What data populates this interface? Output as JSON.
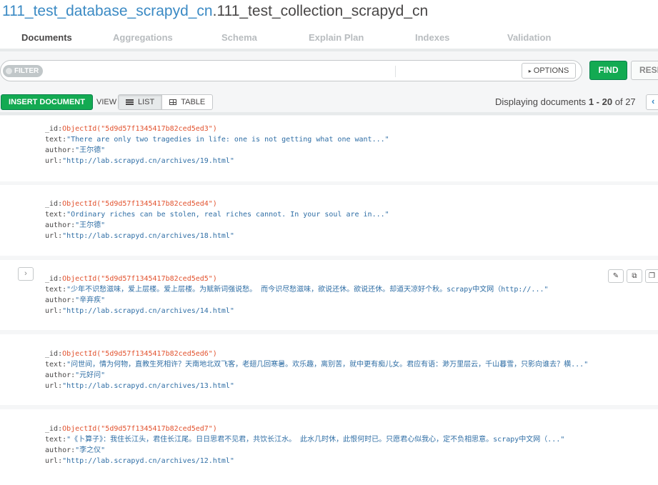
{
  "header": {
    "db_name": "111_test_database_scrapyd_cn",
    "separator": ".",
    "collection_name": "111_test_collection_scrapyd_cn"
  },
  "tabs": [
    {
      "label": "Documents",
      "active": true
    },
    {
      "label": "Aggregations",
      "active": false
    },
    {
      "label": "Schema",
      "active": false
    },
    {
      "label": "Explain Plan",
      "active": false
    },
    {
      "label": "Indexes",
      "active": false
    },
    {
      "label": "Validation",
      "active": false
    }
  ],
  "query": {
    "filter_label": "FILTER",
    "options_label": "OPTIONS",
    "find_label": "FIND",
    "reset_label": "RESET"
  },
  "toolbar": {
    "insert_label": "INSERT DOCUMENT",
    "view_label": "VIEW",
    "list_label": "LIST",
    "table_label": "TABLE",
    "display_prefix": "Displaying documents",
    "range_start": "1",
    "range_sep": "-",
    "range_end": "20",
    "of_label": "of",
    "total": "27"
  },
  "field_keys": {
    "id": "_id",
    "text": "text",
    "author": "author",
    "url": "url"
  },
  "documents": [
    {
      "id": "ObjectId(\"5d9d57f1345417b82ced5ed3\")",
      "text": "\"There are only two tragedies in life: one is not getting what one want...\"",
      "author": "\"王尔德\"",
      "url": "\"http://lab.scrapyd.cn/archives/19.html\""
    },
    {
      "id": "ObjectId(\"5d9d57f1345417b82ced5ed4\")",
      "text": "\"Ordinary riches can be stolen, real riches cannot. In your soul are in...\"",
      "author": "\"王尔德\"",
      "url": "\"http://lab.scrapyd.cn/archives/18.html\""
    },
    {
      "id": "ObjectId(\"5d9d57f1345417b82ced5ed5\")",
      "text": "\"少年不识愁滋味，爱上层楼。爱上层楼。为赋新词强说愁。 而今识尽愁滋味，欲说还休。欲说还休。却道天凉好个秋。scrapy中文网（http://...\"",
      "author": "\"辛弃疾\"",
      "url": "\"http://lab.scrapyd.cn/archives/14.html\""
    },
    {
      "id": "ObjectId(\"5d9d57f1345417b82ced5ed6\")",
      "text": "\"问世间，情为何物，直教生死相许？天南地北双飞客，老翅几回寒暑。欢乐趣，离别苦，就中更有痴儿女。君应有语：渺万里层云，千山暮雪，只影向谁去？横...\"",
      "author": "\"元好问\"",
      "url": "\"http://lab.scrapyd.cn/archives/13.html\""
    },
    {
      "id": "ObjectId(\"5d9d57f1345417b82ced5ed7\")",
      "text": "\"《卜算子》：我住长江头，君住长江尾。日日思君不见君，共饮长江水。 此水几时休，此恨何时已。只愿君心似我心，定不负相思意。scrapy中文网（...\"",
      "author": "\"李之仪\"",
      "url": "\"http://lab.scrapyd.cn/archives/12.html\""
    }
  ]
}
